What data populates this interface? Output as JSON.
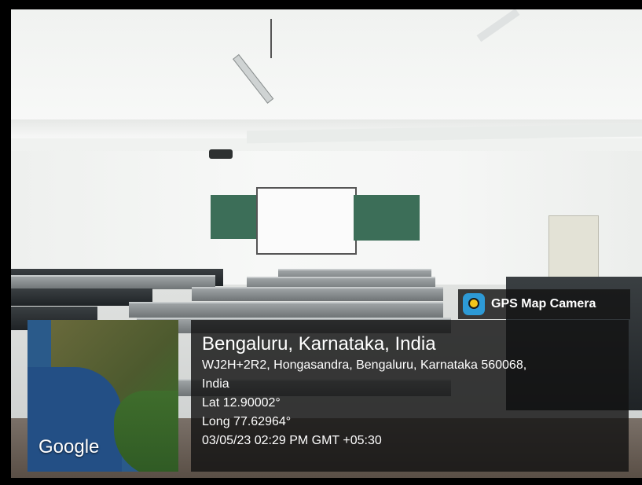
{
  "app": {
    "name": "GPS Map Camera",
    "icon": "gps-map-camera-icon"
  },
  "map": {
    "attribution": "Google"
  },
  "location": {
    "title": "Bengaluru, Karnataka, India",
    "address_line1": "WJ2H+2R2, Hongasandra, Bengaluru, Karnataka 560068,",
    "address_line2": "India",
    "latitude": "Lat 12.90002°",
    "longitude": "Long 77.62964°",
    "datetime": "03/05/23 02:29 PM GMT +05:30"
  },
  "colors": {
    "overlay_background": "#121212",
    "chalkboard": "#3c6e58",
    "frame": "#000000"
  }
}
